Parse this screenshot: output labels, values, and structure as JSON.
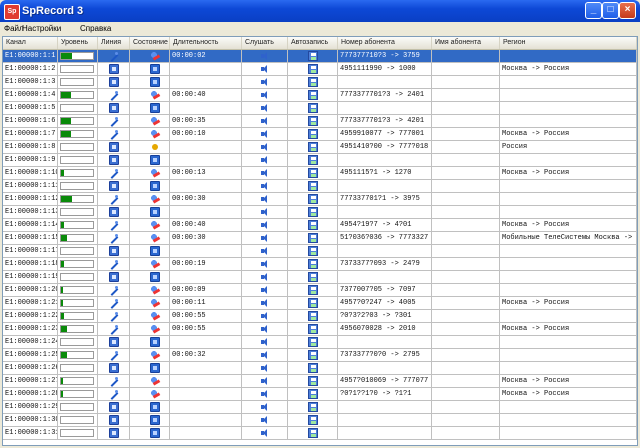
{
  "window": {
    "title": "SpRecord 3",
    "app_icon_text": "Sp"
  },
  "menu": [
    "Файл",
    "Настройки",
    "Справка"
  ],
  "columns": [
    "Канал",
    "Уровень",
    "Линия",
    "Состояние",
    "Длительность",
    "Слушать",
    "Автозапись",
    "Номер абонента",
    "Имя абонента",
    "Регион"
  ],
  "colors": {
    "title_bar": "#0d48d6",
    "selection": "#316ac5",
    "level_fill": "#0a8a0a"
  },
  "rows": [
    {
      "channel": "E1:00000:1:1",
      "level": 0.35,
      "line": "busy",
      "state": "talk",
      "duration": "00:00:02",
      "number": "777377710?3 -> 3759",
      "region": "",
      "selected": true
    },
    {
      "channel": "E1:00000:1:2",
      "level": 0.0,
      "line": "on",
      "state": "idle",
      "duration": "",
      "number": "4951111990 -> 1000",
      "region": "Москва -> Россия",
      "selected": false
    },
    {
      "channel": "E1:00000:1:3",
      "level": 0.0,
      "line": "on",
      "state": "idle",
      "duration": "",
      "number": "",
      "region": "",
      "selected": false
    },
    {
      "channel": "E1:00000:1:4",
      "level": 0.3,
      "line": "busy",
      "state": "talk",
      "duration": "00:00:40",
      "number": "7773377701?3 -> 2401",
      "region": "",
      "selected": false
    },
    {
      "channel": "E1:00000:1:5",
      "level": 0.0,
      "line": "on",
      "state": "idle",
      "duration": "",
      "number": "",
      "region": "",
      "selected": false
    },
    {
      "channel": "E1:00000:1:6",
      "level": 0.3,
      "line": "busy",
      "state": "talk",
      "duration": "00:00:35",
      "number": "7773377701?3 -> 4201",
      "region": "",
      "selected": false
    },
    {
      "channel": "E1:00000:1:7",
      "level": 0.3,
      "line": "busy",
      "state": "talk",
      "duration": "00:00:10",
      "number": "4959910077 -> 777001",
      "region": "Москва -> Россия",
      "selected": false
    },
    {
      "channel": "E1:00000:1:8",
      "level": 0.0,
      "line": "on",
      "state": "ring",
      "duration": "",
      "number": "4951410?00 -> 777?018",
      "region": "Россия",
      "selected": false
    },
    {
      "channel": "E1:00000:1:9",
      "level": 0.0,
      "line": "on",
      "state": "idle",
      "duration": "",
      "number": "",
      "region": "",
      "selected": false
    },
    {
      "channel": "E1:00000:1:10",
      "level": 0.1,
      "line": "busy",
      "state": "talk",
      "duration": "00:00:13",
      "number": "4951115?1 -> 1270",
      "region": "Москва -> Россия",
      "selected": false
    },
    {
      "channel": "E1:00000:1:11",
      "level": 0.0,
      "line": "on",
      "state": "idle",
      "duration": "",
      "number": "",
      "region": "",
      "selected": false
    },
    {
      "channel": "E1:00000:1:12",
      "level": 0.35,
      "line": "busy",
      "state": "talk",
      "duration": "00:00:30",
      "number": "777337701?1 -> 39?5",
      "region": "",
      "selected": false
    },
    {
      "channel": "E1:00000:1:13",
      "level": 0.0,
      "line": "on",
      "state": "idle",
      "duration": "",
      "number": "",
      "region": "",
      "selected": false
    },
    {
      "channel": "E1:00000:1:14",
      "level": 0.1,
      "line": "busy",
      "state": "talk",
      "duration": "00:00:40",
      "number": "4954?19?7 -> 4?01",
      "region": "Москва -> Россия",
      "selected": false
    },
    {
      "channel": "E1:00000:1:15",
      "level": 0.2,
      "line": "busy",
      "state": "talk",
      "duration": "00:00:30",
      "number": "51?036?036 -> 7773327",
      "region": "Мобильные ТелеСистемы Москва -> Р",
      "selected": false
    },
    {
      "channel": "E1:00000:1:17",
      "level": 0.0,
      "line": "on",
      "state": "idle",
      "duration": "",
      "number": "",
      "region": "",
      "selected": false
    },
    {
      "channel": "E1:00000:1:18",
      "level": 0.1,
      "line": "busy",
      "state": "talk",
      "duration": "00:00:19",
      "number": "7373377?093 -> 24?9",
      "region": "",
      "selected": false
    },
    {
      "channel": "E1:00000:1:19",
      "level": 0.0,
      "line": "on",
      "state": "idle",
      "duration": "",
      "number": "",
      "region": "",
      "selected": false
    },
    {
      "channel": "E1:00000:1:20",
      "level": 0.05,
      "line": "busy",
      "state": "talk",
      "duration": "00:00:09",
      "number": "7377007?05 -> 7097",
      "region": "",
      "selected": false
    },
    {
      "channel": "E1:00000:1:21",
      "level": 0.05,
      "line": "busy",
      "state": "talk",
      "duration": "00:00:11",
      "number": "4957?0?247 -> 4005",
      "region": "Москва -> Россия",
      "selected": false
    },
    {
      "channel": "E1:00000:1:22",
      "level": 0.1,
      "line": "busy",
      "state": "talk",
      "duration": "00:00:55",
      "number": "?0?3?2?03 -> ?301",
      "region": "",
      "selected": false
    },
    {
      "channel": "E1:00000:1:23",
      "level": 0.2,
      "line": "busy",
      "state": "talk",
      "duration": "00:00:55",
      "number": "4956070028 -> 2010",
      "region": "Москва -> Россия",
      "selected": false
    },
    {
      "channel": "E1:00000:1:24",
      "level": 0.0,
      "line": "on",
      "state": "idle",
      "duration": "",
      "number": "",
      "region": "",
      "selected": false
    },
    {
      "channel": "E1:00000:1:25",
      "level": 0.2,
      "line": "busy",
      "state": "talk",
      "duration": "00:00:32",
      "number": "7373377?0?0 -> 2795",
      "region": "",
      "selected": false
    },
    {
      "channel": "E1:00000:1:26",
      "level": 0.0,
      "line": "on",
      "state": "idle",
      "duration": "",
      "number": "",
      "region": "",
      "selected": false
    },
    {
      "channel": "E1:00000:1:27",
      "level": 0.05,
      "line": "busy",
      "state": "talk",
      "duration": "",
      "number": "4957?010069 -> 777077",
      "region": "Москва -> Россия",
      "selected": false
    },
    {
      "channel": "E1:00000:1:28",
      "level": 0.05,
      "line": "busy",
      "state": "talk",
      "duration": "",
      "number": "?0?1??1?0 -> ?1?1",
      "region": "Москва -> Россия",
      "selected": false
    },
    {
      "channel": "E1:00000:1:29",
      "level": 0.0,
      "line": "on",
      "state": "idle",
      "duration": "",
      "number": "",
      "region": "",
      "selected": false
    },
    {
      "channel": "E1:00000:1:30",
      "level": 0.0,
      "line": "on",
      "state": "idle",
      "duration": "",
      "number": "",
      "region": "",
      "selected": false
    },
    {
      "channel": "E1:00000:1:31",
      "level": 0.0,
      "line": "on",
      "state": "idle",
      "duration": "",
      "number": "",
      "region": "",
      "selected": false
    }
  ]
}
